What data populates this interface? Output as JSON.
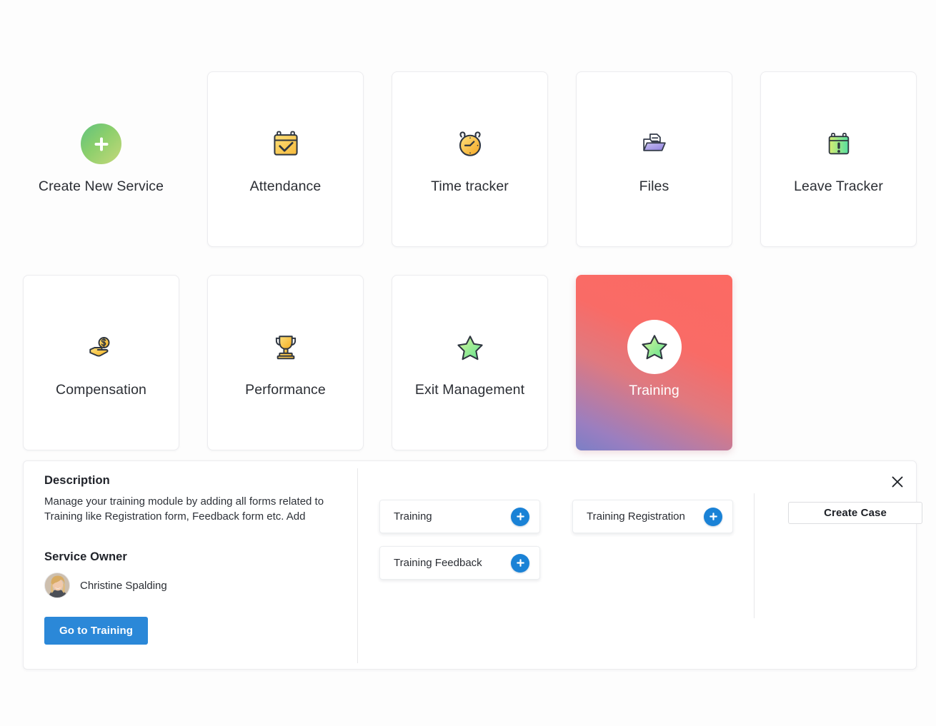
{
  "services": [
    {
      "id": "create-new-service",
      "label": "Create New Service",
      "icon": "plus-circle-icon",
      "type": "create",
      "selected": false
    },
    {
      "id": "attendance",
      "label": "Attendance",
      "icon": "calendar-check-icon",
      "type": "service",
      "selected": false
    },
    {
      "id": "time-tracker",
      "label": "Time tracker",
      "icon": "alarm-clock-icon",
      "type": "service",
      "selected": false
    },
    {
      "id": "files",
      "label": "Files",
      "icon": "open-folder-icon",
      "type": "service",
      "selected": false
    },
    {
      "id": "leave-tracker",
      "label": "Leave Tracker",
      "icon": "calendar-alert-icon",
      "type": "service",
      "selected": false
    },
    {
      "id": "compensation",
      "label": "Compensation",
      "icon": "hand-coin-icon",
      "type": "service",
      "selected": false
    },
    {
      "id": "performance",
      "label": "Performance",
      "icon": "trophy-icon",
      "type": "service",
      "selected": false
    },
    {
      "id": "exit-management",
      "label": "Exit Management",
      "icon": "star-icon",
      "type": "service",
      "selected": false
    },
    {
      "id": "training",
      "label": "Training",
      "icon": "star-icon",
      "type": "service",
      "selected": true
    }
  ],
  "detail": {
    "description_title": "Description",
    "description_text": "Manage your training module by adding all forms related to Training like Registration form, Feedback form etc. Add",
    "owner_title": "Service Owner",
    "owner_name": "Christine Spalding",
    "primary_button": "Go to Training",
    "secondary_button": "Create Case",
    "close_icon": "close-icon",
    "forms": [
      {
        "label": "Training"
      },
      {
        "label": "Training Registration"
      },
      {
        "label": "Training Feedback"
      }
    ]
  },
  "colors": {
    "accent_blue": "#2b88d8",
    "plus_blue": "#1a82d6",
    "selected_gradient_start": "#fc6a63",
    "selected_gradient_end": "#7b7fc6",
    "create_gradient_start": "#5fc27e",
    "create_gradient_end": "#c6d87a",
    "card_border": "#ececef",
    "text_primary": "#2b2e34"
  }
}
